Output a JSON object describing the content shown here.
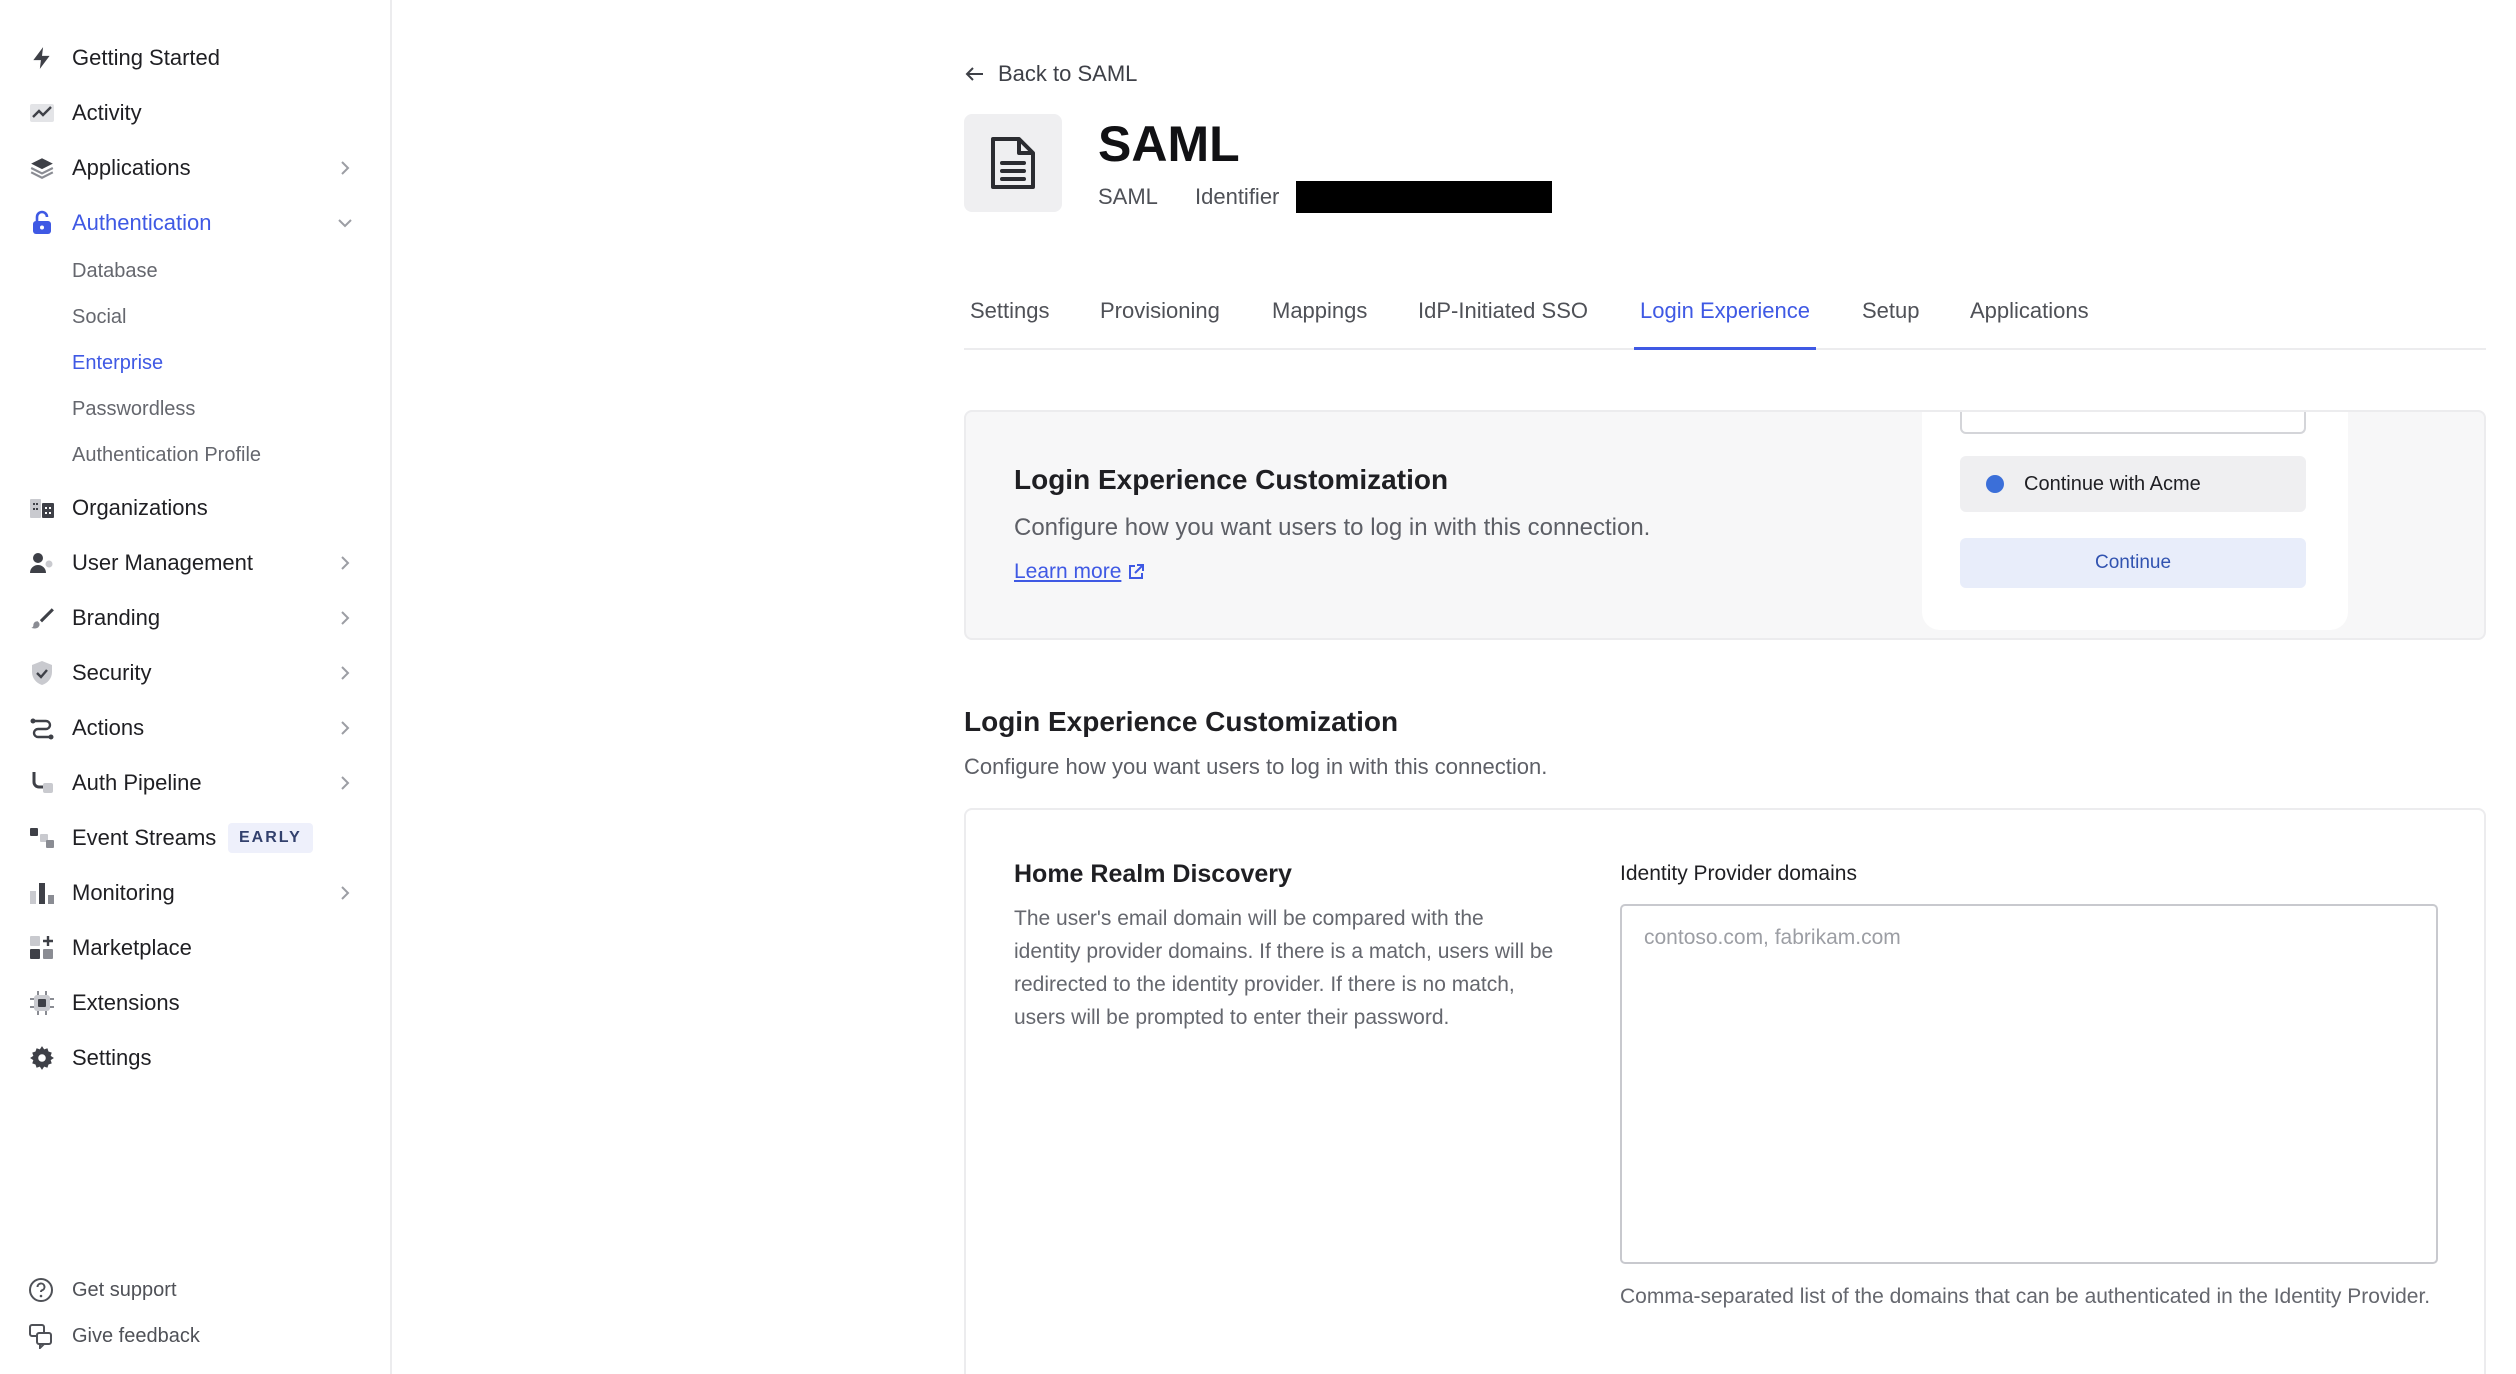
{
  "sidebar": {
    "items": [
      {
        "label": "Getting Started",
        "icon": "bolt-icon"
      },
      {
        "label": "Activity",
        "icon": "activity-chart-icon"
      },
      {
        "label": "Applications",
        "icon": "layers-icon"
      },
      {
        "label": "Authentication",
        "icon": "lock-icon"
      },
      {
        "label": "Organizations",
        "icon": "building-icon"
      },
      {
        "label": "User Management",
        "icon": "users-icon"
      },
      {
        "label": "Branding",
        "icon": "brush-icon"
      },
      {
        "label": "Security",
        "icon": "shield-icon"
      },
      {
        "label": "Actions",
        "icon": "flow-icon"
      },
      {
        "label": "Auth Pipeline",
        "icon": "pipeline-icon"
      },
      {
        "label": "Event Streams",
        "icon": "streams-icon",
        "badge": "EARLY"
      },
      {
        "label": "Monitoring",
        "icon": "bar-chart-icon"
      },
      {
        "label": "Marketplace",
        "icon": "grid-plus-icon"
      },
      {
        "label": "Extensions",
        "icon": "chip-icon"
      },
      {
        "label": "Settings",
        "icon": "gear-icon"
      }
    ],
    "auth_subitems": [
      {
        "label": "Database"
      },
      {
        "label": "Social"
      },
      {
        "label": "Enterprise"
      },
      {
        "label": "Passwordless"
      },
      {
        "label": "Authentication Profile"
      }
    ],
    "footer": {
      "support": "Get support",
      "feedback": "Give feedback"
    }
  },
  "header": {
    "back_label": "Back to SAML",
    "title": "SAML",
    "type": "SAML",
    "identifier_label": "Identifier"
  },
  "tabs": [
    {
      "label": "Settings"
    },
    {
      "label": "Provisioning"
    },
    {
      "label": "Mappings"
    },
    {
      "label": "IdP-Initiated SSO"
    },
    {
      "label": "Login Experience"
    },
    {
      "label": "Setup"
    },
    {
      "label": "Applications"
    }
  ],
  "active_tab": "Login Experience",
  "preview": {
    "title": "Login Experience Customization",
    "description": "Configure how you want users to log in with this connection.",
    "learn_more": "Learn more",
    "sso_button": "Continue with Acme",
    "continue_button": "Continue"
  },
  "section": {
    "title": "Login Experience Customization",
    "description": "Configure how you want users to log in with this connection."
  },
  "hrd": {
    "title": "Home Realm Discovery",
    "description": "The user's email domain will be compared with the identity provider domains. If there is a match, users will be redirected to the identity provider. If there is no match, users will be prompted to enter their password.",
    "field_label": "Identity Provider domains",
    "placeholder": "contoso.com, fabrikam.com",
    "value": "",
    "help": "Comma-separated list of the domains that can be authenticated in the Identity Provider."
  },
  "colors": {
    "accent": "#3f59e4",
    "text": "#1f1f23",
    "muted": "#65676e"
  }
}
